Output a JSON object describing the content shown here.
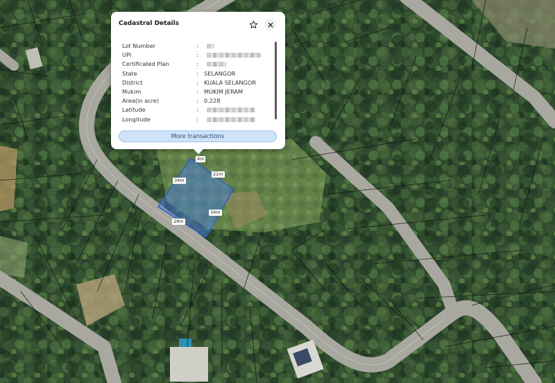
{
  "popup": {
    "title": "Cadastral Details",
    "star_icon": "star-icon",
    "close_icon": "close-icon",
    "rows": [
      {
        "key": "Lot Number",
        "value": ""
      },
      {
        "key": "UPI",
        "value": ""
      },
      {
        "key": "Certificated Plan",
        "value": ""
      },
      {
        "key": "State",
        "value": "SELANGOR"
      },
      {
        "key": "District",
        "value": "KUALA SELANGOR"
      },
      {
        "key": "Mukim",
        "value": "MUKIM JERAM"
      },
      {
        "key": "Area(in acre)",
        "value": "0.228"
      },
      {
        "key": "Latitude",
        "value": ""
      },
      {
        "key": "Longitude",
        "value": ""
      }
    ],
    "separator": ":",
    "more_button": "More transactions"
  },
  "map": {
    "dimensions": [
      "4m",
      "22m",
      "34m",
      "34m",
      "28m"
    ],
    "parcel_color": "#4a7ee0"
  }
}
